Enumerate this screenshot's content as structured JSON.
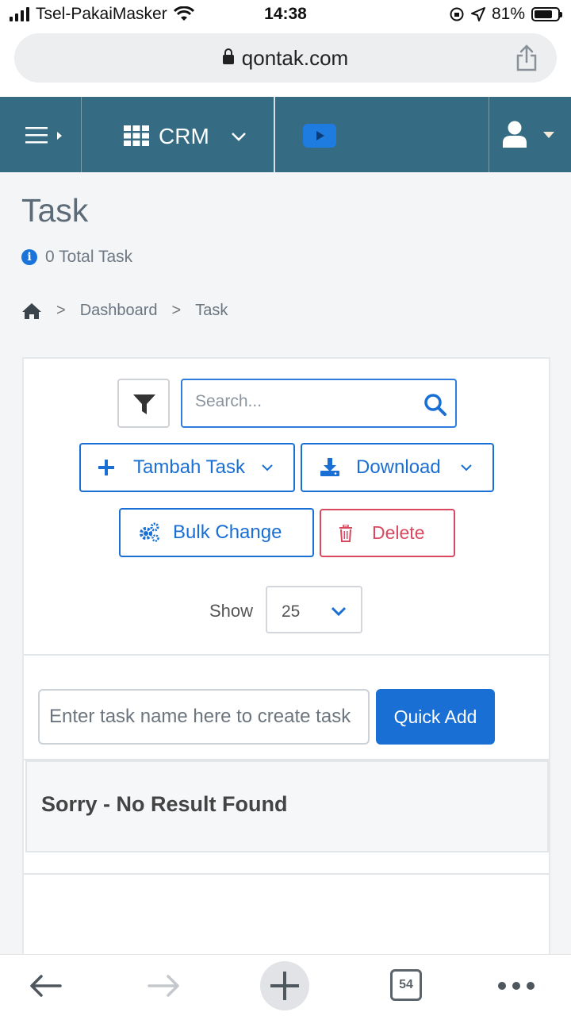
{
  "status_bar": {
    "carrier": "Tsel-PakaiMasker",
    "time": "14:38",
    "battery_percent": "81%"
  },
  "browser": {
    "url": "qontak.com",
    "tab_count": "54"
  },
  "header": {
    "app_label": "CRM",
    "colors": {
      "bar": "#356b83",
      "video": "#1e7be0"
    }
  },
  "page": {
    "title": "Task",
    "total_label": "0 Total Task",
    "breadcrumb": [
      "Dashboard",
      "Task"
    ]
  },
  "toolbar": {
    "search_placeholder": "Search...",
    "add_task_label": "Tambah Task",
    "download_label": "Download",
    "bulk_change_label": "Bulk Change",
    "delete_label": "Delete",
    "show_label": "Show",
    "show_value": "25"
  },
  "quick_add": {
    "placeholder": "Enter task name here to create task",
    "button_label": "Quick Add"
  },
  "results": {
    "empty_message": "Sorry - No Result Found"
  },
  "colors": {
    "primary": "#1a6fd4",
    "danger": "#d9485f"
  }
}
